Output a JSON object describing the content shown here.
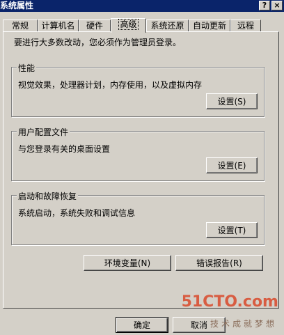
{
  "window": {
    "title": "系统属性",
    "help_glyph": "?",
    "close_glyph": "×"
  },
  "tabs": [
    {
      "label": "常规"
    },
    {
      "label": "计算机名"
    },
    {
      "label": "硬件"
    },
    {
      "label": "高级"
    },
    {
      "label": "系统还原"
    },
    {
      "label": "自动更新"
    },
    {
      "label": "远程"
    }
  ],
  "notice": "要进行大多数改动，您必须作为管理员登录。",
  "groups": {
    "performance": {
      "title": "性能",
      "desc": "视觉效果，处理器计划，内存使用，以及虚拟内存",
      "button": "设置(S)"
    },
    "profiles": {
      "title": "用户配置文件",
      "desc": "与您登录有关的桌面设置",
      "button": "设置(E)"
    },
    "startup": {
      "title": "启动和故障恢复",
      "desc": "系统启动，系统失败和调试信息",
      "button": "设置(T)"
    }
  },
  "buttons": {
    "env": "环境变量(N)",
    "error": "错误报告(R)",
    "ok": "确定",
    "cancel": "取消"
  },
  "watermark": {
    "main": "51CTO.com",
    "sub": "技术成就梦想"
  }
}
